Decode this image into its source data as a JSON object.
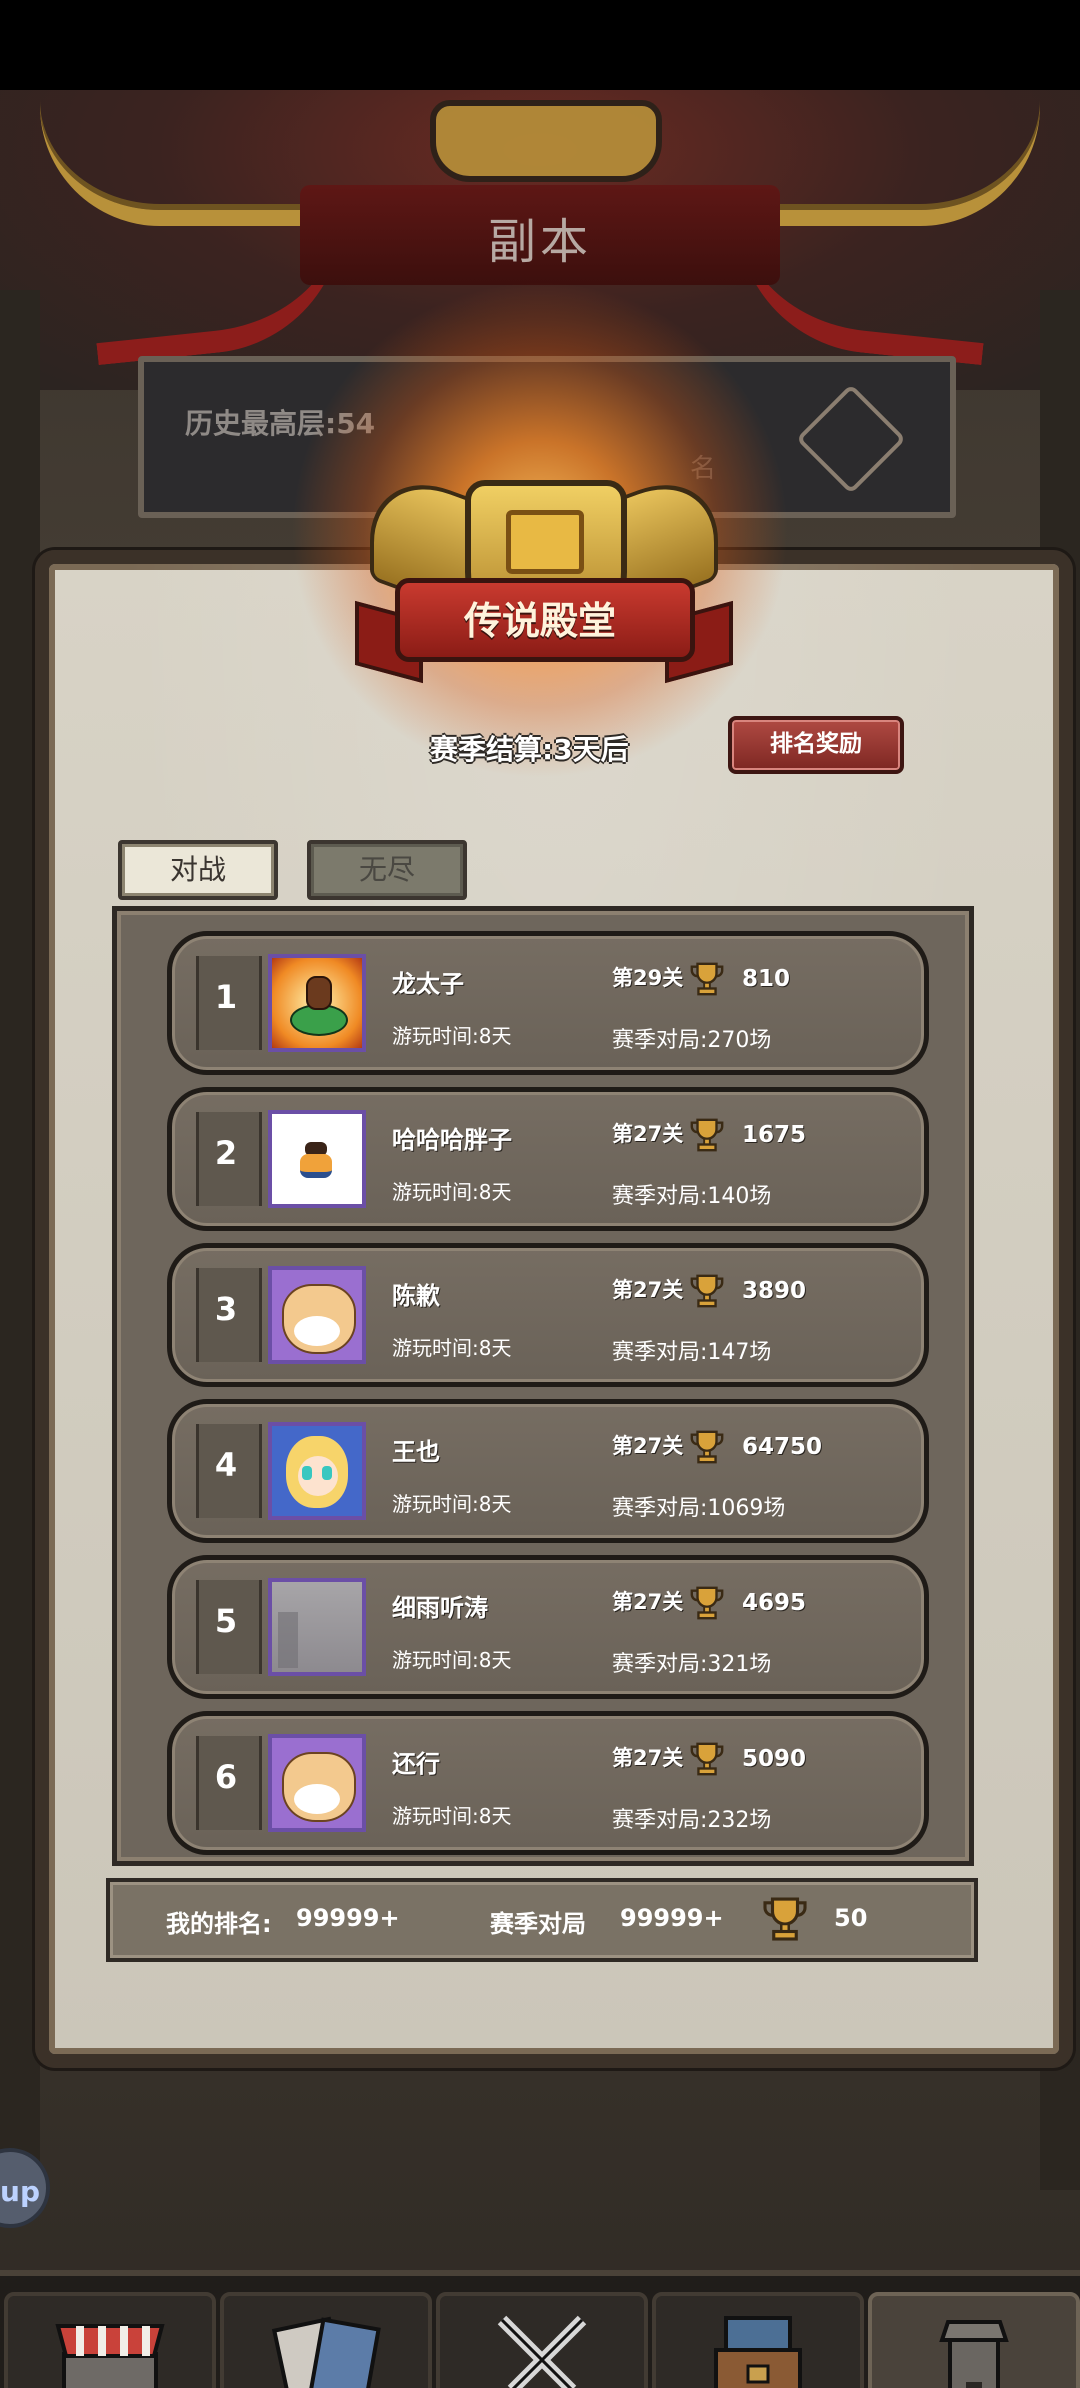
{
  "header": {
    "title": "副本"
  },
  "background_panel": {
    "history_best": "历史最高层:54",
    "rank_hint": "名"
  },
  "hall": {
    "title": "传说殿堂",
    "season_text": "赛季结算:3天后",
    "reward_button": "排名奖励",
    "tabs": [
      {
        "label": "对战",
        "active": true
      },
      {
        "label": "无尽",
        "active": false
      }
    ]
  },
  "leaderboard": [
    {
      "rank": "1",
      "name": "龙太子",
      "playtime": "游玩时间:8天",
      "stage": "第29关",
      "trophies": "810",
      "games": "赛季对局:270场",
      "avatar": "dragon-rider-icon"
    },
    {
      "rank": "2",
      "name": "哈哈哈胖子",
      "playtime": "游玩时间:8天",
      "stage": "第27关",
      "trophies": "1675",
      "games": "赛季对局:140场",
      "avatar": "fat-person-icon"
    },
    {
      "rank": "3",
      "name": "陈歉",
      "playtime": "游玩时间:8天",
      "stage": "第27关",
      "trophies": "3890",
      "games": "赛季对局:147场",
      "avatar": "shiba-dog-icon"
    },
    {
      "rank": "4",
      "name": "王也",
      "playtime": "游玩时间:8天",
      "stage": "第27关",
      "trophies": "64750",
      "games": "赛季对局:1069场",
      "avatar": "anime-girl-icon"
    },
    {
      "rank": "5",
      "name": "细雨听涛",
      "playtime": "游玩时间:8天",
      "stage": "第27关",
      "trophies": "4695",
      "games": "赛季对局:321场",
      "avatar": "misty-landscape-icon"
    },
    {
      "rank": "6",
      "name": "还行",
      "playtime": "游玩时间:8天",
      "stage": "第27关",
      "trophies": "5090",
      "games": "赛季对局:232场",
      "avatar": "shiba-dog-icon"
    }
  ],
  "my_rank": {
    "rank_label": "我的排名:",
    "rank_value": "99999+",
    "games_label": "赛季对局",
    "games_value": "99999+",
    "trophies": "50"
  },
  "side_bubble": "up",
  "nav": [
    {
      "label": "商店",
      "icon": "shop-icon",
      "active": false
    },
    {
      "label": "抽卡",
      "icon": "card-draw-icon",
      "active": false
    },
    {
      "label": "战斗",
      "icon": "crossed-swords-icon",
      "active": false
    },
    {
      "label": "卡组",
      "icon": "card-deck-icon",
      "active": false
    },
    {
      "label": "副本",
      "icon": "tower-icon",
      "active": true
    }
  ],
  "colors": {
    "accent_red": "#8b1c16",
    "gold": "#e6c15a",
    "panel": "#d8d3c6",
    "avatar_border": "#6b4fa6"
  }
}
